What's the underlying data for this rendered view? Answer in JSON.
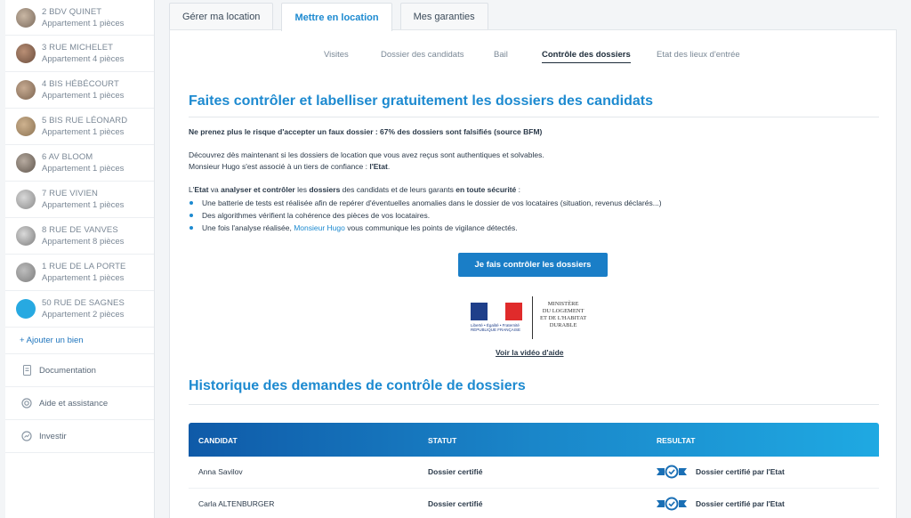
{
  "sidebar": {
    "properties": [
      {
        "name": "2 BDV QUINET",
        "type": "Appartement 1 pièces"
      },
      {
        "name": "3 RUE MICHELET",
        "type": "Appartement 4 pièces"
      },
      {
        "name": "4 BIS HÉBÉCOURT",
        "type": "Appartement 1 pièces"
      },
      {
        "name": "5 BIS RUE LÉONARD",
        "type": "Appartement 1 pièces"
      },
      {
        "name": "6 AV BLOOM",
        "type": "Appartement 1 pièces"
      },
      {
        "name": "7 RUE VIVIEN",
        "type": "Appartement 1 pièces"
      },
      {
        "name": "8 RUE DE VANVES",
        "type": "Appartement 8 pièces"
      },
      {
        "name": "1 RUE DE LA PORTE",
        "type": "Appartement 1 pièces"
      },
      {
        "name": "50 RUE DE SAGNES",
        "type": "Appartement 2 pièces"
      }
    ],
    "add_label": "+ Ajouter un bien",
    "links": [
      {
        "label": "Documentation",
        "icon": "document-icon"
      },
      {
        "label": "Aide et assistance",
        "icon": "lifebuoy-icon"
      },
      {
        "label": "Investir",
        "icon": "invest-icon"
      }
    ]
  },
  "tabs": [
    "Gérer ma location",
    "Mettre en location",
    "Mes garanties"
  ],
  "active_tab": "Mettre en location",
  "subnav": [
    "Visites",
    "Dossier des candidats",
    "Bail",
    "Contrôle des dossiers",
    "Etat des lieux d'entrée"
  ],
  "active_subnav": "Contrôle des dossiers",
  "main": {
    "title": "Faites contrôler et labelliser gratuitement les dossiers des candidats",
    "warning": "Ne prenez plus le risque d'accepter un faux dossier : 67% des dossiers sont falsifiés (source BFM)",
    "intro_line1": "Découvrez dès maintenant si les dossiers de location que vous avez reçus sont authentiques et solvables.",
    "intro_line2_prefix": "Monsieur Hugo s'est associé à un tiers de confiance : ",
    "intro_line2_bold": "l'Etat",
    "intro_line2_suffix": ".",
    "state_line": {
      "p1": "L'",
      "b1": "Etat",
      "p2": " va ",
      "b2": "analyser et contrôler",
      "p3": " les ",
      "b3": "dossiers",
      "p4": " des candidats et de leurs garants ",
      "b4": "en toute sécurité",
      "p5": " :"
    },
    "bullets": [
      "Une batterie de tests est réalisée afin de repérer d'éventuelles anomalies dans le dossier de vos locataires (situation, revenus déclarés...)",
      "Des algorithmes vérifient la cohérence des pièces de vos locataires."
    ],
    "bullet3_prefix": "Une fois l'analyse réalisée, ",
    "bullet3_link": "Monsieur Hugo",
    "bullet3_suffix": " vous communique les points de vigilance détectés.",
    "cta": "Je fais contrôler les dossiers",
    "logo": {
      "motto": "Liberté • Égalité • Fraternité",
      "republic": "RÉPUBLIQUE FRANÇAISE",
      "ministry_lines": [
        "MINISTÈRE",
        "DU LOGEMENT",
        "ET DE L'HABITAT",
        "DURABLE"
      ]
    },
    "video_link": "Voir la vidéo d'aide",
    "history_title": "Historique des demandes de contrôle de dossiers",
    "table": {
      "headers": [
        "CANDIDAT",
        "STATUT",
        "RESULTAT"
      ],
      "rows": [
        {
          "candidate": "Anna Savilov",
          "status": "Dossier certifié",
          "result": "Dossier certifié par l'Etat"
        },
        {
          "candidate": "Carla ALTENBURGER",
          "status": "Dossier certifié",
          "result": "Dossier certifié par l'Etat"
        }
      ]
    }
  },
  "colors": {
    "accent": "#1d8ad0",
    "button": "#1a7ec7",
    "header_start": "#0f5aa8",
    "header_end": "#1fa9e2"
  }
}
